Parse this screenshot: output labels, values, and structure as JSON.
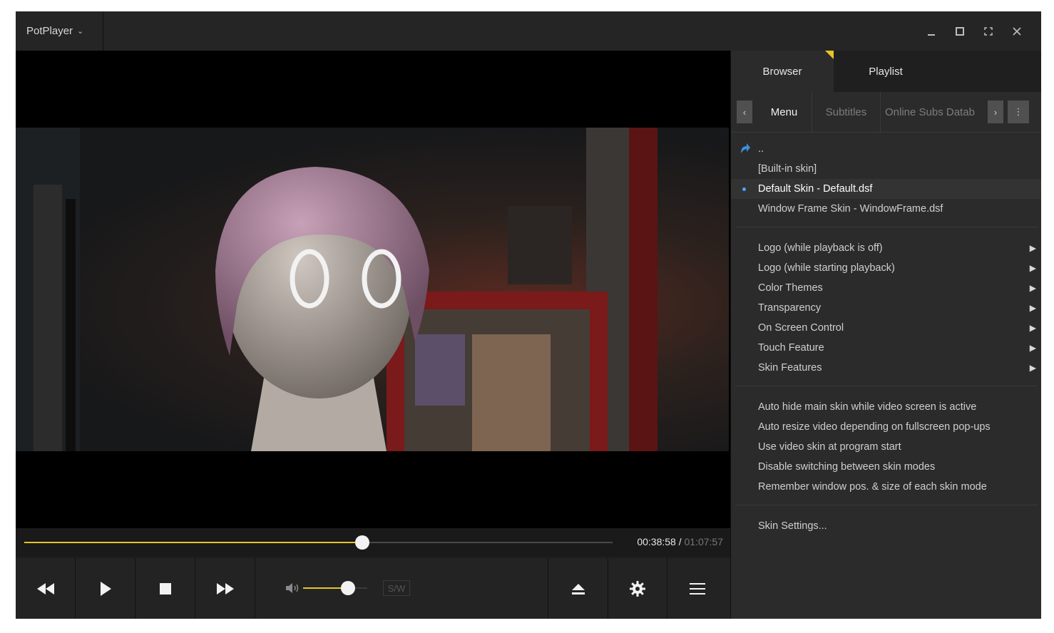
{
  "app": {
    "title": "PotPlayer"
  },
  "window_buttons": {
    "minimize": "_",
    "restore": "□",
    "fullscreen": "⛶",
    "close": "✕"
  },
  "progress": {
    "current": "00:38:58",
    "separator": " / ",
    "total": "01:07:57",
    "fraction": 0.574
  },
  "volume": {
    "fraction": 0.7,
    "sw_label": "S/W"
  },
  "colors": {
    "accent": "#e6c52b",
    "panel_bg": "#2b2b2b",
    "selected_dot": "#4da3ff"
  },
  "panel": {
    "tabs": [
      {
        "label": "Browser"
      },
      {
        "label": "Playlist"
      }
    ],
    "subtabs": [
      {
        "label": "Menu"
      },
      {
        "label": "Subtitles"
      },
      {
        "label": "Online Subs Datab"
      }
    ],
    "items": [
      {
        "label": "..",
        "icon": "back-arrow-icon"
      },
      {
        "label": "[Built-in skin]"
      },
      {
        "label": "Default Skin - Default.dsf",
        "selected": true
      },
      {
        "label": "Window Frame Skin - WindowFrame.dsf"
      },
      {
        "label": "Logo (while playback is off)",
        "submenu": true
      },
      {
        "label": "Logo (while starting playback)",
        "submenu": true
      },
      {
        "label": "Color Themes",
        "submenu": true
      },
      {
        "label": "Transparency",
        "submenu": true
      },
      {
        "label": "On Screen Control",
        "submenu": true
      },
      {
        "label": "Touch Feature",
        "submenu": true
      },
      {
        "label": "Skin Features",
        "submenu": true
      },
      {
        "label": "Auto hide main skin while video screen is active"
      },
      {
        "label": "Auto resize video depending on fullscreen pop-ups"
      },
      {
        "label": "Use video skin at program start"
      },
      {
        "label": "Disable switching between skin modes"
      },
      {
        "label": "Remember window pos. & size of each skin mode"
      },
      {
        "label": "Skin Settings..."
      }
    ]
  }
}
